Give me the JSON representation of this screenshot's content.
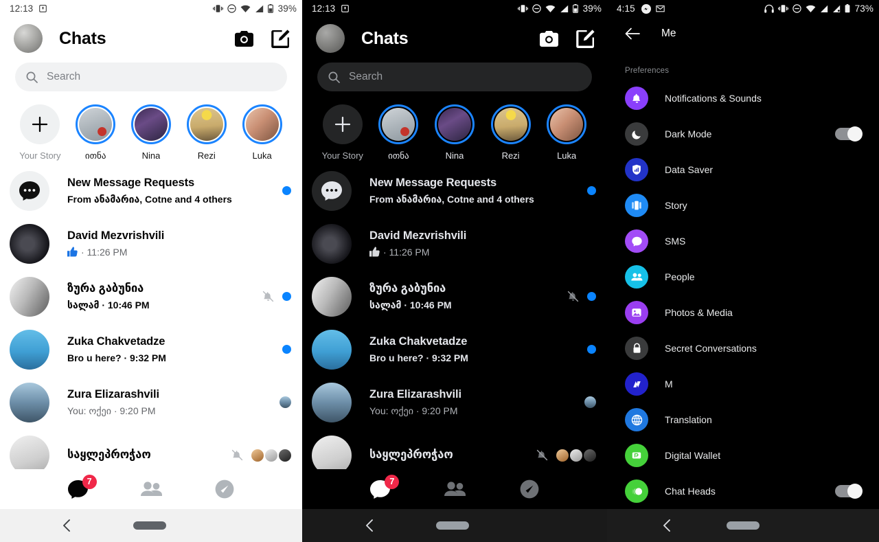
{
  "panel_light": {
    "status": {
      "time": "12:13",
      "battery": "39%",
      "icons": [
        "cast-icon",
        "vibrate-icon",
        "do-not-disturb-icon",
        "wifi-icon",
        "signal-icon",
        "battery-icon"
      ]
    },
    "header": {
      "title": "Chats",
      "avatar": "user-avatar",
      "camera_label": "camera-icon",
      "compose_label": "compose-icon"
    },
    "search": {
      "placeholder": "Search",
      "icon": "search-icon"
    },
    "stories": [
      {
        "label": "Your Story",
        "type": "add",
        "muted": true
      },
      {
        "label": "ითნა",
        "type": "story",
        "muted": false
      },
      {
        "label": "Nina",
        "type": "story",
        "muted": false
      },
      {
        "label": "Rezi",
        "type": "story",
        "muted": false
      },
      {
        "label": "Luka",
        "type": "story",
        "muted": false
      }
    ],
    "chats": [
      {
        "name": "New Message Requests",
        "sub": "From ანამარია, Cotne and 4 others",
        "unread": true,
        "sub_bold": true,
        "right": "dot"
      },
      {
        "name": "David Mezvrishvili",
        "sub": "· 11:26 PM",
        "prefix_icon": "thumbs-up-icon",
        "unread": false,
        "right": "none"
      },
      {
        "name": "ზურა გაბუნია",
        "sub": "სალამ · 10:46 PM",
        "sub_bold": true,
        "unread": true,
        "right": "mute-dot"
      },
      {
        "name": "Zuka Chakvetadze",
        "sub": "Bro u here? · 9:32 PM",
        "sub_bold": true,
        "unread": true,
        "right": "dot"
      },
      {
        "name": "Zura Elizarashvili",
        "sub": "You: ოქეი · 9:20 PM",
        "sub_bold": false,
        "unread": false,
        "right": "seen"
      },
      {
        "name": "საყლეპროჭაო",
        "sub": "",
        "unread": false,
        "right": "mute-thumbs"
      }
    ],
    "tabs": [
      {
        "name": "chats-tab",
        "icon": "chat-bubble-icon",
        "badge": "7",
        "active": true
      },
      {
        "name": "people-tab",
        "icon": "people-icon",
        "badge": "",
        "active": false
      },
      {
        "name": "discover-tab",
        "icon": "compass-icon",
        "badge": "",
        "active": false
      }
    ],
    "navbar": {
      "back": "back-chevron-icon",
      "home": "home-pill"
    }
  },
  "panel_dark": {
    "status": {
      "time": "12:13",
      "battery": "39%"
    },
    "header": {
      "title": "Chats"
    },
    "search": {
      "placeholder": "Search"
    },
    "stories": [
      {
        "label": "Your Story",
        "type": "add",
        "muted": true
      },
      {
        "label": "ითნა",
        "type": "story",
        "muted": false
      },
      {
        "label": "Nina",
        "type": "story",
        "muted": false
      },
      {
        "label": "Rezi",
        "type": "story",
        "muted": false
      },
      {
        "label": "Luka",
        "type": "story",
        "muted": false
      }
    ],
    "chats": [
      {
        "name": "New Message Requests",
        "sub": "From ანამარია, Cotne and 4 others",
        "unread": true,
        "sub_bold": true,
        "right": "dot"
      },
      {
        "name": "David Mezvrishvili",
        "sub": "· 11:26 PM",
        "prefix_icon": "thumbs-up-icon",
        "unread": false,
        "right": "none"
      },
      {
        "name": "ზურა გაბუნია",
        "sub": "სალამ · 10:46 PM",
        "sub_bold": true,
        "unread": true,
        "right": "mute-dot"
      },
      {
        "name": "Zuka Chakvetadze",
        "sub": "Bro u here? · 9:32 PM",
        "sub_bold": true,
        "unread": true,
        "right": "dot"
      },
      {
        "name": "Zura Elizarashvili",
        "sub": "You: ოქეი · 9:20 PM",
        "sub_bold": false,
        "unread": false,
        "right": "seen"
      },
      {
        "name": "საყლეპროჭაო",
        "sub": "",
        "unread": false,
        "right": "mute-thumbs"
      }
    ],
    "tabs": [
      {
        "name": "chats-tab",
        "icon": "chat-bubble-icon",
        "badge": "7",
        "active": true
      },
      {
        "name": "people-tab",
        "icon": "people-icon",
        "badge": "",
        "active": false
      },
      {
        "name": "discover-tab",
        "icon": "compass-icon",
        "badge": "",
        "active": false
      }
    ]
  },
  "panel_settings": {
    "status": {
      "time": "4:15",
      "battery": "73%",
      "icons": [
        "messenger-icon",
        "unread-icon",
        "headphones-icon",
        "vibrate-icon",
        "do-not-disturb-icon",
        "wifi-icon",
        "signal-icon",
        "signal2-icon",
        "battery-icon"
      ]
    },
    "header": {
      "back": "back-arrow-icon",
      "title": "Me"
    },
    "section_title": "Preferences",
    "items": [
      {
        "label": "Notifications & Sounds",
        "icon": "bell-icon",
        "color": "#8a3ffc",
        "toggle": null
      },
      {
        "label": "Dark Mode",
        "icon": "moon-icon",
        "color": "#3a3b3c",
        "toggle": true
      },
      {
        "label": "Data Saver",
        "icon": "shield-icon",
        "color": "#2233c8",
        "toggle": null
      },
      {
        "label": "Story",
        "icon": "story-icon",
        "color": "#1f8bf5",
        "toggle": null
      },
      {
        "label": "SMS",
        "icon": "sms-icon",
        "color": "#a24cf7",
        "toggle": null
      },
      {
        "label": "People",
        "icon": "people-icon",
        "color": "#16c1e8",
        "toggle": null
      },
      {
        "label": "Photos & Media",
        "icon": "photo-icon",
        "color": "#9a3ef0",
        "toggle": null
      },
      {
        "label": "Secret Conversations",
        "icon": "lock-icon",
        "color": "#3a3b3c",
        "toggle": null
      },
      {
        "label": "M",
        "icon": "m-icon",
        "color": "#2222cc",
        "toggle": null
      },
      {
        "label": "Translation",
        "icon": "globe-icon",
        "color": "#1f78e0",
        "toggle": null
      },
      {
        "label": "Digital Wallet",
        "icon": "wallet-icon",
        "color": "#45d13a",
        "toggle": null
      },
      {
        "label": "Chat Heads",
        "icon": "chatheads-icon",
        "color": "#45d13a",
        "toggle": true
      }
    ],
    "navbar": {
      "back": "back-chevron-icon",
      "home": "home-pill"
    }
  },
  "colors": {
    "accent": "#0a84ff",
    "story_ring": "#1b84ff",
    "badge": "#f02849"
  }
}
